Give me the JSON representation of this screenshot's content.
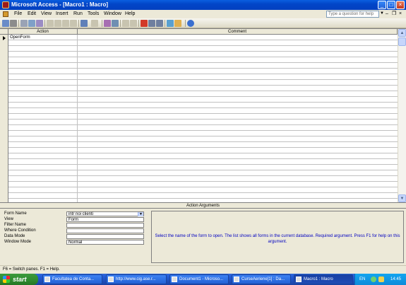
{
  "window": {
    "title": "Microsoft Access - [Macro1 : Macro]"
  },
  "menu": {
    "items": [
      "File",
      "Edit",
      "View",
      "Insert",
      "Run",
      "Tools",
      "Window",
      "Help"
    ],
    "help_placeholder": "Type a question for help"
  },
  "grid": {
    "headers": {
      "action": "Action",
      "comment": "Comment"
    },
    "rows": [
      {
        "action": "OpenForm",
        "comment": ""
      }
    ]
  },
  "args": {
    "header": "Action Arguments",
    "fields": [
      {
        "label": "Form Name",
        "value": "intr noi clienti"
      },
      {
        "label": "View",
        "value": "Form"
      },
      {
        "label": "Filter Name",
        "value": ""
      },
      {
        "label": "Where Condition",
        "value": ""
      },
      {
        "label": "Data Mode",
        "value": ""
      },
      {
        "label": "Window Mode",
        "value": "Normal"
      }
    ],
    "help": "Select the name of the form to open. The list shows all forms in the current database. Required argument. Press F1 for help on this argument."
  },
  "status": {
    "text": "F6 = Switch panes.  F1 = Help."
  },
  "taskbar": {
    "start": "start",
    "tasks": [
      "Facultatea de Conta...",
      "http://www.cig.ase.r...",
      "Document1 - Microso...",
      "CurseAeriene[1] : Da...",
      "Macro1 : Macro"
    ],
    "lang": "EN",
    "clock": "14:45"
  },
  "colors": {
    "titlebar": "#0A5FE0",
    "taskbar": "#245EDB",
    "help_text": "#0000C0"
  }
}
